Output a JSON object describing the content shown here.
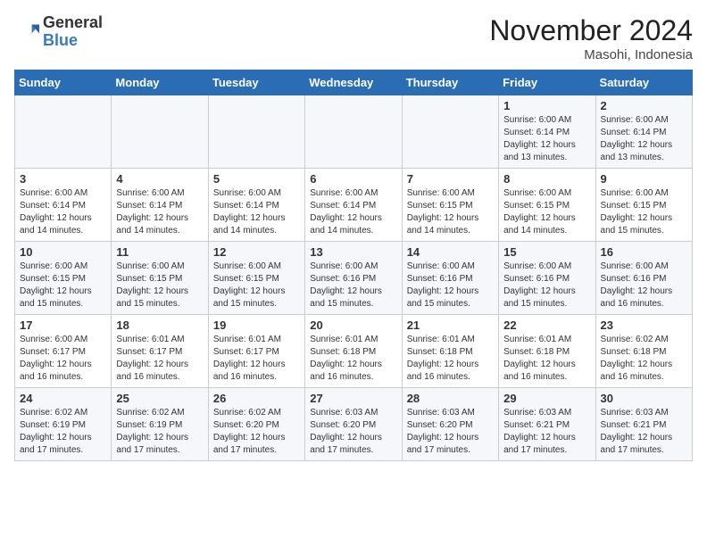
{
  "header": {
    "logo_general": "General",
    "logo_blue": "Blue",
    "month": "November 2024",
    "location": "Masohi, Indonesia"
  },
  "weekdays": [
    "Sunday",
    "Monday",
    "Tuesday",
    "Wednesday",
    "Thursday",
    "Friday",
    "Saturday"
  ],
  "weeks": [
    [
      {
        "day": "",
        "info": ""
      },
      {
        "day": "",
        "info": ""
      },
      {
        "day": "",
        "info": ""
      },
      {
        "day": "",
        "info": ""
      },
      {
        "day": "",
        "info": ""
      },
      {
        "day": "1",
        "info": "Sunrise: 6:00 AM\nSunset: 6:14 PM\nDaylight: 12 hours\nand 13 minutes."
      },
      {
        "day": "2",
        "info": "Sunrise: 6:00 AM\nSunset: 6:14 PM\nDaylight: 12 hours\nand 13 minutes."
      }
    ],
    [
      {
        "day": "3",
        "info": "Sunrise: 6:00 AM\nSunset: 6:14 PM\nDaylight: 12 hours\nand 14 minutes."
      },
      {
        "day": "4",
        "info": "Sunrise: 6:00 AM\nSunset: 6:14 PM\nDaylight: 12 hours\nand 14 minutes."
      },
      {
        "day": "5",
        "info": "Sunrise: 6:00 AM\nSunset: 6:14 PM\nDaylight: 12 hours\nand 14 minutes."
      },
      {
        "day": "6",
        "info": "Sunrise: 6:00 AM\nSunset: 6:14 PM\nDaylight: 12 hours\nand 14 minutes."
      },
      {
        "day": "7",
        "info": "Sunrise: 6:00 AM\nSunset: 6:15 PM\nDaylight: 12 hours\nand 14 minutes."
      },
      {
        "day": "8",
        "info": "Sunrise: 6:00 AM\nSunset: 6:15 PM\nDaylight: 12 hours\nand 14 minutes."
      },
      {
        "day": "9",
        "info": "Sunrise: 6:00 AM\nSunset: 6:15 PM\nDaylight: 12 hours\nand 15 minutes."
      }
    ],
    [
      {
        "day": "10",
        "info": "Sunrise: 6:00 AM\nSunset: 6:15 PM\nDaylight: 12 hours\nand 15 minutes."
      },
      {
        "day": "11",
        "info": "Sunrise: 6:00 AM\nSunset: 6:15 PM\nDaylight: 12 hours\nand 15 minutes."
      },
      {
        "day": "12",
        "info": "Sunrise: 6:00 AM\nSunset: 6:15 PM\nDaylight: 12 hours\nand 15 minutes."
      },
      {
        "day": "13",
        "info": "Sunrise: 6:00 AM\nSunset: 6:16 PM\nDaylight: 12 hours\nand 15 minutes."
      },
      {
        "day": "14",
        "info": "Sunrise: 6:00 AM\nSunset: 6:16 PM\nDaylight: 12 hours\nand 15 minutes."
      },
      {
        "day": "15",
        "info": "Sunrise: 6:00 AM\nSunset: 6:16 PM\nDaylight: 12 hours\nand 15 minutes."
      },
      {
        "day": "16",
        "info": "Sunrise: 6:00 AM\nSunset: 6:16 PM\nDaylight: 12 hours\nand 16 minutes."
      }
    ],
    [
      {
        "day": "17",
        "info": "Sunrise: 6:00 AM\nSunset: 6:17 PM\nDaylight: 12 hours\nand 16 minutes."
      },
      {
        "day": "18",
        "info": "Sunrise: 6:01 AM\nSunset: 6:17 PM\nDaylight: 12 hours\nand 16 minutes."
      },
      {
        "day": "19",
        "info": "Sunrise: 6:01 AM\nSunset: 6:17 PM\nDaylight: 12 hours\nand 16 minutes."
      },
      {
        "day": "20",
        "info": "Sunrise: 6:01 AM\nSunset: 6:18 PM\nDaylight: 12 hours\nand 16 minutes."
      },
      {
        "day": "21",
        "info": "Sunrise: 6:01 AM\nSunset: 6:18 PM\nDaylight: 12 hours\nand 16 minutes."
      },
      {
        "day": "22",
        "info": "Sunrise: 6:01 AM\nSunset: 6:18 PM\nDaylight: 12 hours\nand 16 minutes."
      },
      {
        "day": "23",
        "info": "Sunrise: 6:02 AM\nSunset: 6:18 PM\nDaylight: 12 hours\nand 16 minutes."
      }
    ],
    [
      {
        "day": "24",
        "info": "Sunrise: 6:02 AM\nSunset: 6:19 PM\nDaylight: 12 hours\nand 17 minutes."
      },
      {
        "day": "25",
        "info": "Sunrise: 6:02 AM\nSunset: 6:19 PM\nDaylight: 12 hours\nand 17 minutes."
      },
      {
        "day": "26",
        "info": "Sunrise: 6:02 AM\nSunset: 6:20 PM\nDaylight: 12 hours\nand 17 minutes."
      },
      {
        "day": "27",
        "info": "Sunrise: 6:03 AM\nSunset: 6:20 PM\nDaylight: 12 hours\nand 17 minutes."
      },
      {
        "day": "28",
        "info": "Sunrise: 6:03 AM\nSunset: 6:20 PM\nDaylight: 12 hours\nand 17 minutes."
      },
      {
        "day": "29",
        "info": "Sunrise: 6:03 AM\nSunset: 6:21 PM\nDaylight: 12 hours\nand 17 minutes."
      },
      {
        "day": "30",
        "info": "Sunrise: 6:03 AM\nSunset: 6:21 PM\nDaylight: 12 hours\nand 17 minutes."
      }
    ]
  ]
}
